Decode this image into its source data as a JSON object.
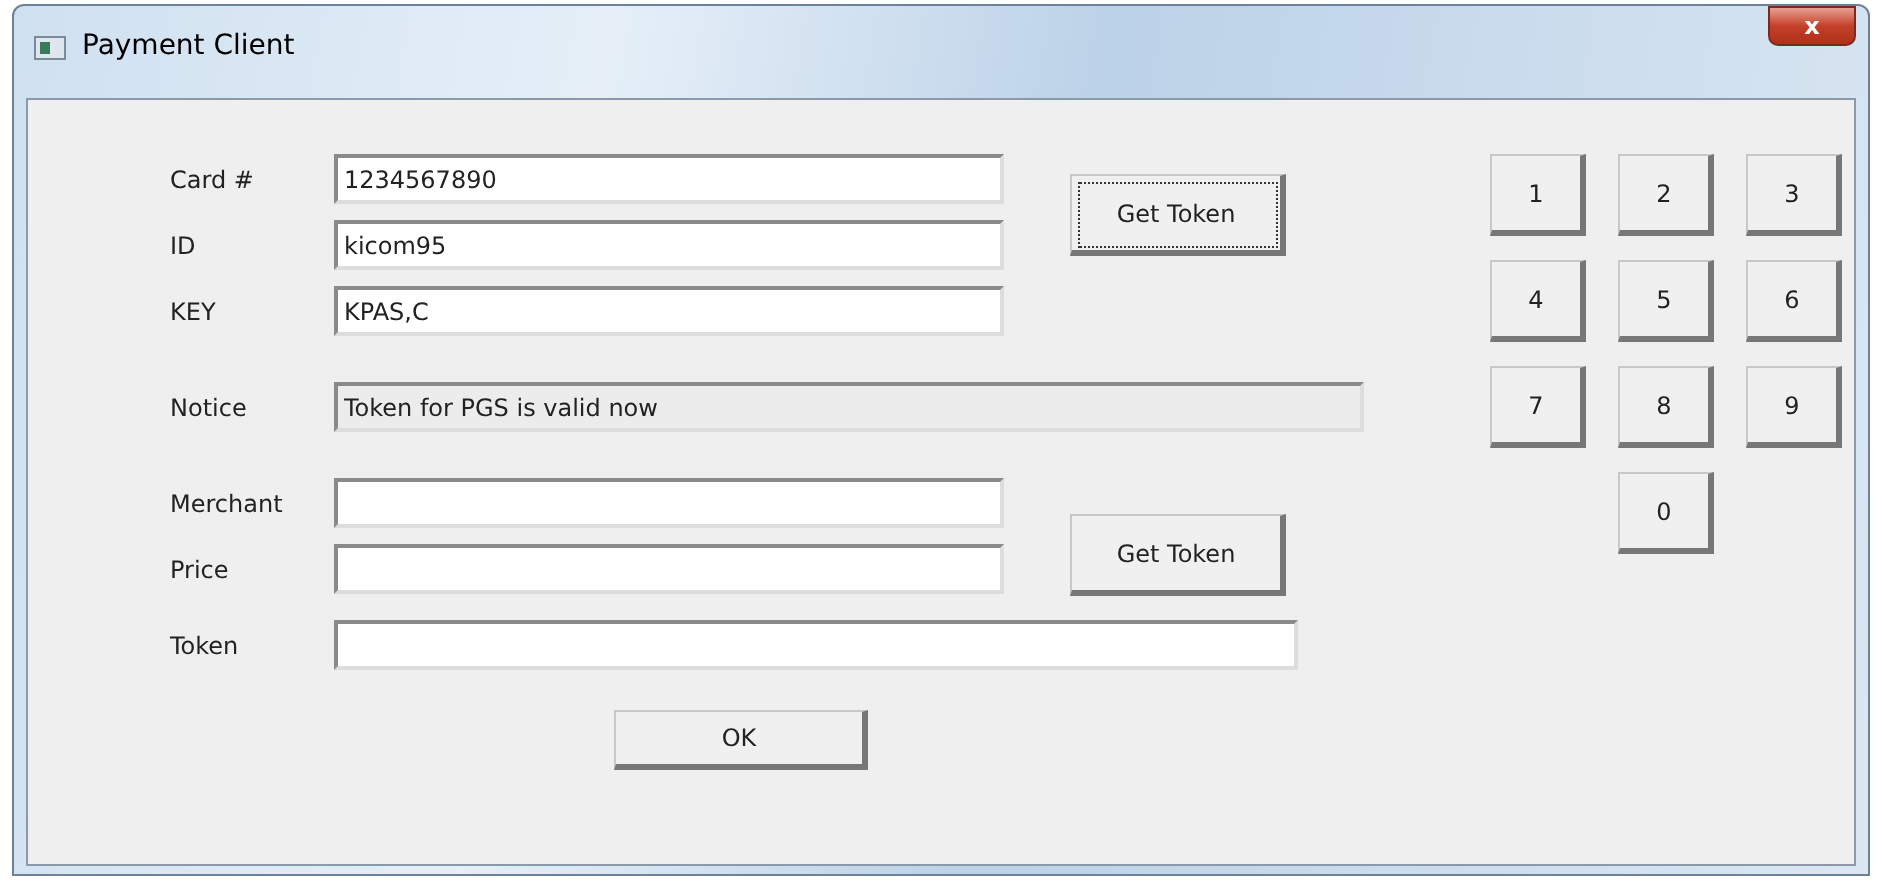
{
  "window": {
    "title": "Payment Client",
    "close": "x"
  },
  "group1": {
    "fields": [
      {
        "label": "Card #",
        "value": "1234567890"
      },
      {
        "label": "ID",
        "value": "kicom95"
      },
      {
        "label": "KEY",
        "value": "KPAS,C"
      }
    ],
    "button": {
      "label": "Get Token",
      "focused": true
    }
  },
  "notice": {
    "label": "Notice",
    "value": "Token for PGS is valid now",
    "readonly": true
  },
  "group2": {
    "fields": [
      {
        "label": "Merchant"
      },
      {
        "label": "Price"
      }
    ],
    "button": {
      "label": "Get Token",
      "focused": false
    }
  },
  "token": {
    "label": "Token"
  },
  "ok": "OK",
  "keypad": [
    "1",
    "2",
    "3",
    "4",
    "5",
    "6",
    "7",
    "8",
    "9",
    "0"
  ]
}
